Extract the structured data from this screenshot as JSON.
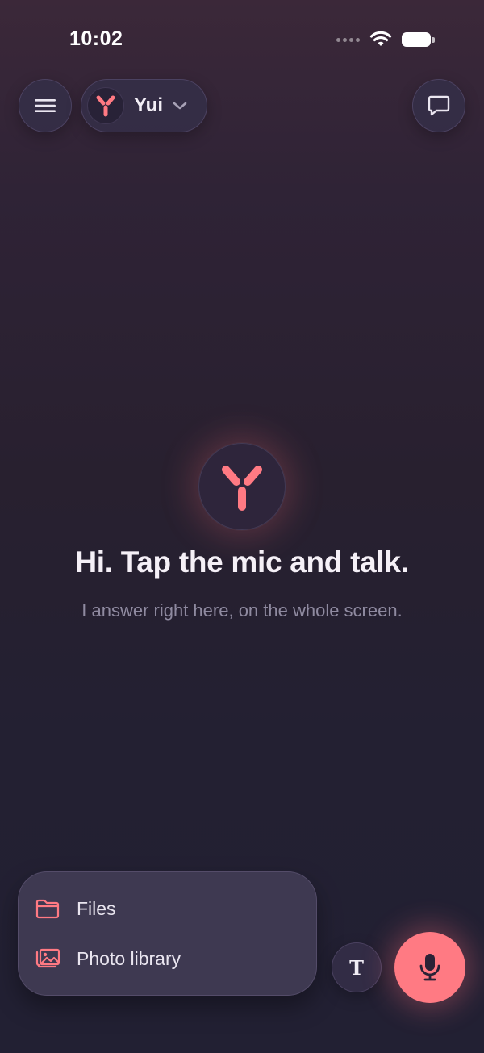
{
  "status_bar": {
    "time": "10:02"
  },
  "header": {
    "assistant_name": "Yui",
    "icons": {
      "menu": "hamburger-icon",
      "logo": "y-logo-icon",
      "dropdown": "chevron-down-icon",
      "chat": "chat-bubble-icon"
    }
  },
  "hero": {
    "title": "Hi. Tap the mic and talk.",
    "subtitle": "I answer right here, on the whole screen."
  },
  "attach_menu": {
    "items": [
      {
        "label": "Files",
        "icon": "folder-icon"
      },
      {
        "label": "Photo library",
        "icon": "photo-library-icon"
      }
    ]
  },
  "composer": {
    "text_button_label": "T",
    "mic_icon": "microphone-icon"
  },
  "colors": {
    "accent": "#ff7a83",
    "background_top": "#3b2839",
    "background_bottom": "#222033",
    "text_primary": "#f5f0f7",
    "text_secondary": "#8f8aa0"
  }
}
